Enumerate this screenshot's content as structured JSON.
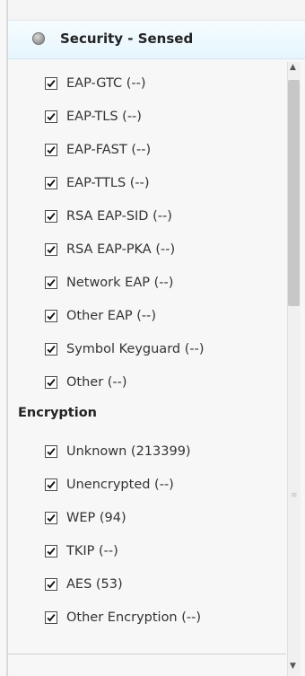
{
  "section": {
    "title": "Security - Sensed",
    "icon": "radio-bullet-icon"
  },
  "groups": [
    {
      "heading": "",
      "items": [
        {
          "label": "EAP-GTC (--)",
          "checked": true
        },
        {
          "label": "EAP-TLS (--)",
          "checked": true
        },
        {
          "label": "EAP-FAST (--)",
          "checked": true
        },
        {
          "label": "EAP-TTLS (--)",
          "checked": true
        },
        {
          "label": "RSA EAP-SID (--)",
          "checked": true
        },
        {
          "label": "RSA EAP-PKA (--)",
          "checked": true
        },
        {
          "label": "Network EAP (--)",
          "checked": true
        },
        {
          "label": "Other EAP (--)",
          "checked": true
        },
        {
          "label": "Symbol Keyguard (--)",
          "checked": true
        },
        {
          "label": "Other (--)",
          "checked": true
        }
      ]
    },
    {
      "heading": "Encryption",
      "items": [
        {
          "label": "Unknown (213399)",
          "checked": true
        },
        {
          "label": "Unencrypted (--)",
          "checked": true
        },
        {
          "label": "WEP (94)",
          "checked": true
        },
        {
          "label": "TKIP (--)",
          "checked": true
        },
        {
          "label": "AES (53)",
          "checked": true
        },
        {
          "label": "Other Encryption (--)",
          "checked": true
        }
      ]
    }
  ],
  "scrollbar": {
    "up_icon": "scroll-up-arrow-icon",
    "down_icon": "scroll-down-arrow-icon"
  }
}
